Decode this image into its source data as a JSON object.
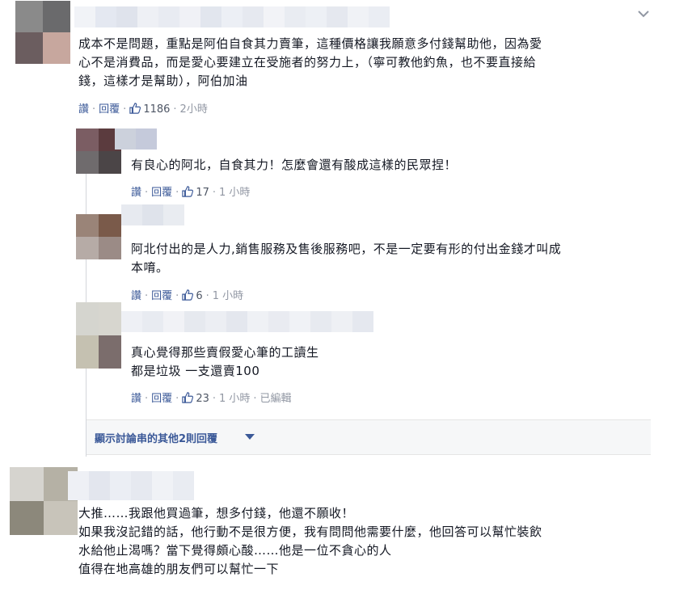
{
  "comments": [
    {
      "text_lines": [
        "成本不是問題，重點是阿伯自食其力賣筆，這種價格讓我願意多付錢幫助他，因為愛",
        "心不是消費品，而是愛心要建立在受施者的努力上，（寧可教他釣魚，也不要直接給",
        "錢，這樣才是幫助），阿伯加油"
      ],
      "like_label": "讚",
      "reply_label": "回覆",
      "like_count": "1186",
      "time": "2小時"
    },
    {
      "text_lines": [
        "有良心的阿北，自食其力！怎麼會還有酸成這樣的民眾捏！"
      ],
      "like_label": "讚",
      "reply_label": "回覆",
      "like_count": "17",
      "time": "1 小時"
    },
    {
      "text_lines": [
        "阿北付出的是人力,銷售服務及售後服務吧，不是一定要有形的付出金錢才叫成",
        "本唷。"
      ],
      "like_label": "讚",
      "reply_label": "回覆",
      "like_count": "6",
      "time": "1 小時"
    },
    {
      "text_lines": [
        "真心覺得那些賣假愛心筆的工讀生",
        "都是垃圾 一支還賣100"
      ],
      "like_label": "讚",
      "reply_label": "回覆",
      "like_count": "23",
      "time": "1 小時",
      "edited": "已編輯"
    },
    {
      "text_lines": [
        "大推……我跟他買過筆，想多付錢，他還不願收！",
        "如果我沒記錯的話，他行動不是很方便，我有問問他需要什麼，他回答可以幫忙裝飲",
        "水給他止渴嗎？當下覺得頗心酸……他是一位不貪心的人",
        "值得在地高雄的朋友們可以幫忙一下"
      ]
    }
  ],
  "more_replies_label": "顯示討論串的其他2則回覆",
  "icons": {
    "like": "thumbs-up-icon",
    "options": "chevron-down-icon",
    "more": "caret-down-icon"
  },
  "colors": {
    "link": "#3b5998",
    "text": "#141823",
    "meta": "#9197a3"
  }
}
